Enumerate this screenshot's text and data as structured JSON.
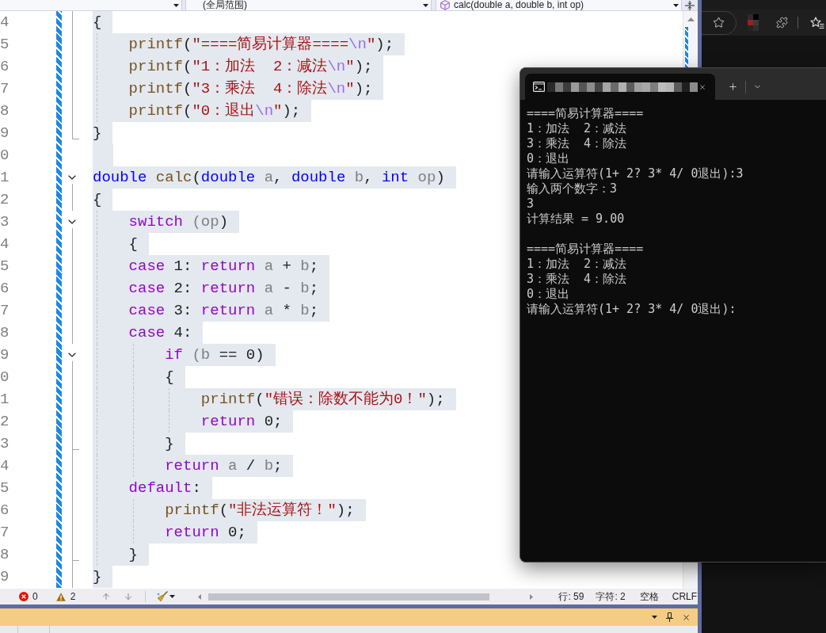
{
  "navigation_bar": {
    "scope": "(全局范围)",
    "member": "calc(double a, double b, int op)"
  },
  "editor": {
    "modified": true,
    "lines": [
      {
        "number": "4",
        "selected": true,
        "fold": {
          "kind": "through"
        },
        "tokens": [
          {
            "kind": "plain",
            "text": "{"
          }
        ]
      },
      {
        "number": "5",
        "selected": true,
        "fold": {
          "kind": "through"
        },
        "tokens": [
          {
            "kind": "function",
            "text": "    printf"
          },
          {
            "kind": "plain",
            "text": "("
          },
          {
            "kind": "string",
            "text": "\"====简易计算器===="
          },
          {
            "kind": "escape",
            "text": "\\n"
          },
          {
            "kind": "string",
            "text": "\""
          },
          {
            "kind": "plain",
            "text": ");"
          }
        ]
      },
      {
        "number": "6",
        "selected": true,
        "fold": {
          "kind": "through"
        },
        "tokens": [
          {
            "kind": "function",
            "text": "    printf"
          },
          {
            "kind": "plain",
            "text": "("
          },
          {
            "kind": "string",
            "text": "\"1：加法  2：减法"
          },
          {
            "kind": "escape",
            "text": "\\n"
          },
          {
            "kind": "string",
            "text": "\""
          },
          {
            "kind": "plain",
            "text": ");"
          }
        ]
      },
      {
        "number": "7",
        "selected": true,
        "fold": {
          "kind": "through"
        },
        "tokens": [
          {
            "kind": "function",
            "text": "    printf"
          },
          {
            "kind": "plain",
            "text": "("
          },
          {
            "kind": "string",
            "text": "\"3：乘法  4：除法"
          },
          {
            "kind": "escape",
            "text": "\\n"
          },
          {
            "kind": "string",
            "text": "\""
          },
          {
            "kind": "plain",
            "text": ");"
          }
        ]
      },
      {
        "number": "8",
        "selected": true,
        "fold": {
          "kind": "through"
        },
        "tokens": [
          {
            "kind": "function",
            "text": "    printf"
          },
          {
            "kind": "plain",
            "text": "("
          },
          {
            "kind": "string",
            "text": "\"0：退出"
          },
          {
            "kind": "escape",
            "text": "\\n"
          },
          {
            "kind": "string",
            "text": "\""
          },
          {
            "kind": "plain",
            "text": ");"
          }
        ]
      },
      {
        "number": "9",
        "selected": true,
        "fold": {
          "kind": "end"
        },
        "tokens": [
          {
            "kind": "plain",
            "text": "}"
          }
        ]
      },
      {
        "number": "0",
        "selected": true
      },
      {
        "number": "1",
        "selected": true,
        "fold": {
          "kind": "start",
          "expanded": true
        },
        "tokens": [
          {
            "kind": "type",
            "text": "double"
          },
          {
            "kind": "function",
            "text": " calc"
          },
          {
            "kind": "plain",
            "text": "("
          },
          {
            "kind": "type",
            "text": "double"
          },
          {
            "kind": "param",
            "text": " a"
          },
          {
            "kind": "plain",
            "text": ", "
          },
          {
            "kind": "type",
            "text": "double"
          },
          {
            "kind": "param",
            "text": " b"
          },
          {
            "kind": "plain",
            "text": ", "
          },
          {
            "kind": "type",
            "text": "int"
          },
          {
            "kind": "param",
            "text": " op"
          },
          {
            "kind": "plain",
            "text": ")"
          }
        ]
      },
      {
        "number": "2",
        "selected": true,
        "fold": {
          "kind": "through"
        },
        "tokens": [
          {
            "kind": "plain",
            "text": "{"
          }
        ]
      },
      {
        "number": "3",
        "selected": true,
        "fold": {
          "kind": "start",
          "expanded": true
        },
        "tokens": [
          {
            "kind": "keyword",
            "text": "    switch"
          },
          {
            "kind": "param",
            "text": " (op"
          },
          {
            "kind": "plain",
            "text": ")"
          }
        ]
      },
      {
        "number": "4",
        "selected": true,
        "fold": {
          "kind": "through"
        },
        "tokens": [
          {
            "kind": "plain",
            "text": "    {"
          }
        ]
      },
      {
        "number": "5",
        "selected": true,
        "fold": {
          "kind": "through"
        },
        "tokens": [
          {
            "kind": "keyword",
            "text": "    case"
          },
          {
            "kind": "plain",
            "text": " 1: "
          },
          {
            "kind": "keyword",
            "text": "return"
          },
          {
            "kind": "param",
            "text": " a"
          },
          {
            "kind": "plain",
            "text": " + "
          },
          {
            "kind": "param",
            "text": "b"
          },
          {
            "kind": "plain",
            "text": ";"
          }
        ]
      },
      {
        "number": "6",
        "selected": true,
        "fold": {
          "kind": "through"
        },
        "tokens": [
          {
            "kind": "keyword",
            "text": "    case"
          },
          {
            "kind": "plain",
            "text": " 2: "
          },
          {
            "kind": "keyword",
            "text": "return"
          },
          {
            "kind": "param",
            "text": " a"
          },
          {
            "kind": "plain",
            "text": " - "
          },
          {
            "kind": "param",
            "text": "b"
          },
          {
            "kind": "plain",
            "text": ";"
          }
        ]
      },
      {
        "number": "7",
        "selected": true,
        "fold": {
          "kind": "through"
        },
        "tokens": [
          {
            "kind": "keyword",
            "text": "    case"
          },
          {
            "kind": "plain",
            "text": " 3: "
          },
          {
            "kind": "keyword",
            "text": "return"
          },
          {
            "kind": "param",
            "text": " a"
          },
          {
            "kind": "plain",
            "text": " * "
          },
          {
            "kind": "param",
            "text": "b"
          },
          {
            "kind": "plain",
            "text": ";"
          }
        ]
      },
      {
        "number": "8",
        "selected": true,
        "fold": {
          "kind": "through"
        },
        "tokens": [
          {
            "kind": "keyword",
            "text": "    case"
          },
          {
            "kind": "plain",
            "text": " 4:"
          }
        ]
      },
      {
        "number": "9",
        "selected": true,
        "fold": {
          "kind": "start",
          "expanded": true
        },
        "tokens": [
          {
            "kind": "keyword",
            "text": "        if"
          },
          {
            "kind": "param",
            "text": " (b"
          },
          {
            "kind": "plain",
            "text": " == 0)"
          }
        ]
      },
      {
        "number": "0",
        "selected": true,
        "fold": {
          "kind": "through"
        },
        "tokens": [
          {
            "kind": "plain",
            "text": "        {"
          }
        ]
      },
      {
        "number": "1",
        "selected": true,
        "fold": {
          "kind": "through"
        },
        "tokens": [
          {
            "kind": "function",
            "text": "            printf"
          },
          {
            "kind": "plain",
            "text": "("
          },
          {
            "kind": "string",
            "text": "\"错误：除数不能为0！\""
          },
          {
            "kind": "plain",
            "text": ");"
          }
        ]
      },
      {
        "number": "2",
        "selected": true,
        "fold": {
          "kind": "through"
        },
        "tokens": [
          {
            "kind": "keyword",
            "text": "            return"
          },
          {
            "kind": "plain",
            "text": " 0;"
          }
        ]
      },
      {
        "number": "3",
        "selected": true,
        "fold": {
          "kind": "inner_end"
        },
        "tokens": [
          {
            "kind": "plain",
            "text": "        }"
          }
        ]
      },
      {
        "number": "4",
        "selected": true,
        "fold": {
          "kind": "through"
        },
        "tokens": [
          {
            "kind": "keyword",
            "text": "        return"
          },
          {
            "kind": "param",
            "text": " a"
          },
          {
            "kind": "plain",
            "text": " / "
          },
          {
            "kind": "param",
            "text": "b"
          },
          {
            "kind": "plain",
            "text": ";"
          }
        ]
      },
      {
        "number": "5",
        "selected": true,
        "fold": {
          "kind": "through"
        },
        "tokens": [
          {
            "kind": "keyword",
            "text": "    default"
          },
          {
            "kind": "plain",
            "text": ":"
          }
        ]
      },
      {
        "number": "6",
        "selected": true,
        "fold": {
          "kind": "through"
        },
        "tokens": [
          {
            "kind": "function",
            "text": "        printf"
          },
          {
            "kind": "plain",
            "text": "("
          },
          {
            "kind": "string",
            "text": "\"非法运算符！\""
          },
          {
            "kind": "plain",
            "text": ");"
          }
        ]
      },
      {
        "number": "7",
        "selected": true,
        "fold": {
          "kind": "through"
        },
        "tokens": [
          {
            "kind": "keyword",
            "text": "        return"
          },
          {
            "kind": "plain",
            "text": " 0;"
          }
        ]
      },
      {
        "number": "8",
        "selected": true,
        "fold": {
          "kind": "inner_end"
        },
        "tokens": [
          {
            "kind": "plain",
            "text": "    }"
          }
        ]
      },
      {
        "number": "9",
        "selected": true,
        "fold": {
          "kind": "through"
        },
        "tokens": [
          {
            "kind": "plain",
            "text": "}"
          }
        ]
      }
    ]
  },
  "terminal": {
    "blocks": [
      [
        "====简易计算器====",
        "1：加法  2：减法",
        "3：乘法  4：除法",
        "0：退出",
        "请输入运算符(1+ 2? 3* 4/ 0退出):3",
        "输入两个数字：3",
        "3",
        "计算结果 = 9.00"
      ],
      [
        "====简易计算器====",
        "1：加法  2：减法",
        "3：乘法  4：除法",
        "0：退出",
        "请输入运算符(1+ 2? 3* 4/ 0退出):"
      ]
    ]
  },
  "status_bar": {
    "errors": "0",
    "warnings": "2",
    "line": "行: 59",
    "column": "字符: 2",
    "indent": "空格",
    "line_ending": "CRLF"
  }
}
